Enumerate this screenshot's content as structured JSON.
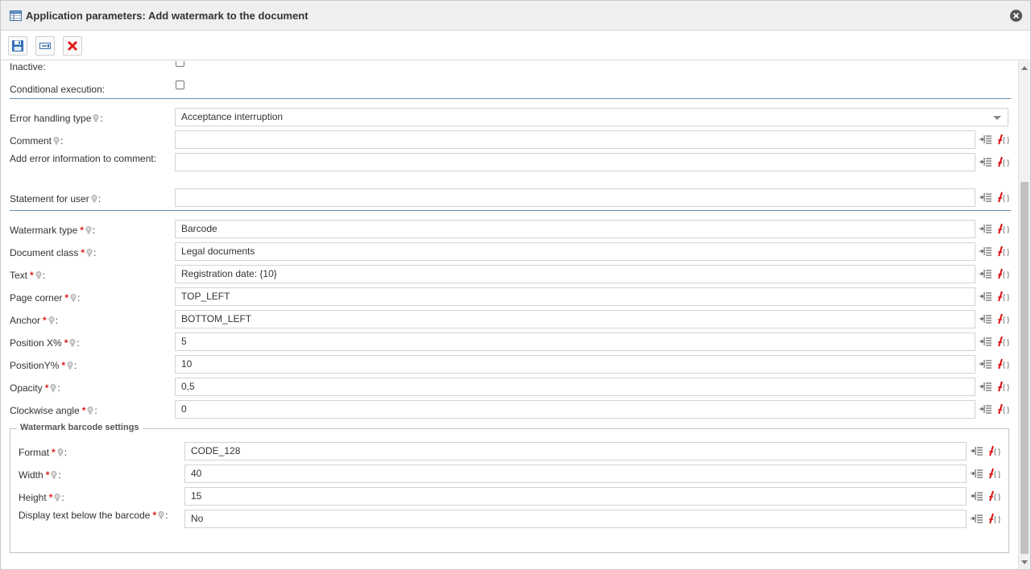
{
  "window": {
    "title": "Application parameters: Add watermark to the document"
  },
  "top_rows": {
    "inactive_label": "Inactive:",
    "conditional_label": "Conditional execution:"
  },
  "error": {
    "type_label": "Error handling type",
    "type_value": "Acceptance interruption",
    "comment_label": "Comment",
    "comment_value": "",
    "add_error_label": "Add error information to comment:",
    "add_error_value": "",
    "statement_label": "Statement for user",
    "statement_value": ""
  },
  "watermark": {
    "type_label": "Watermark type",
    "type_value": "Barcode",
    "class_label": "Document class",
    "class_value": "Legal documents",
    "text_label": "Text",
    "text_value": "Registration date: {10}",
    "corner_label": "Page corner",
    "corner_value": "TOP_LEFT",
    "anchor_label": "Anchor",
    "anchor_value": "BOTTOM_LEFT",
    "posx_label": "Position X%",
    "posx_value": "5",
    "posy_label": "PositionY%",
    "posy_value": "10",
    "opacity_label": "Opacity",
    "opacity_value": "0,5",
    "angle_label": "Clockwise angle",
    "angle_value": "0"
  },
  "barcode": {
    "legend": "Watermark barcode settings",
    "format_label": "Format",
    "format_value": "CODE_128",
    "width_label": "Width",
    "width_value": "40",
    "height_label": "Height",
    "height_value": "15",
    "display_label": "Display text below the barcode",
    "display_value": "No"
  },
  "marks": {
    "required": "*",
    "colon": ":"
  }
}
